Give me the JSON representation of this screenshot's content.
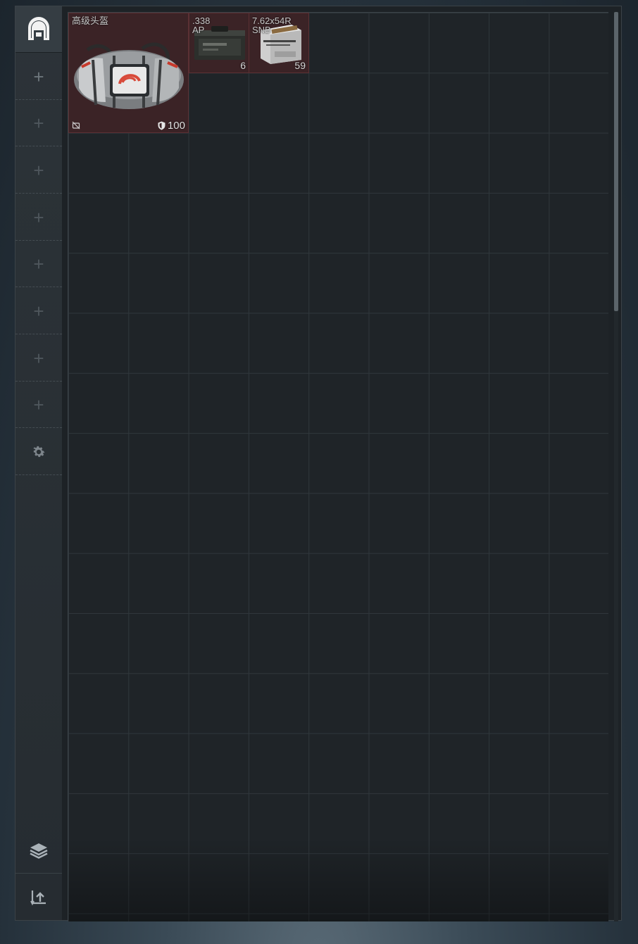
{
  "sidebar": {
    "home_icon": "hideout-icon",
    "slots": [
      "+",
      "+",
      "+",
      "+",
      "+",
      "+",
      "+",
      "+"
    ],
    "settings_icon": "gear-icon",
    "bottom_icons": [
      "layers-icon",
      "sort-upload-icon"
    ]
  },
  "stash": {
    "columns": 9,
    "items": [
      {
        "name": "高级头盔",
        "durability": "100",
        "icon": "duffle-bag"
      },
      {
        "name": ".338\nAP",
        "count": "6",
        "icon": "ammo-can"
      },
      {
        "name": "7.62x54R\nSNB",
        "count": "59",
        "icon": "ammo-box"
      }
    ]
  },
  "colors": {
    "item_background": "#3b2326",
    "grid_line": "#30373c",
    "sidebar": "#2c3338"
  }
}
